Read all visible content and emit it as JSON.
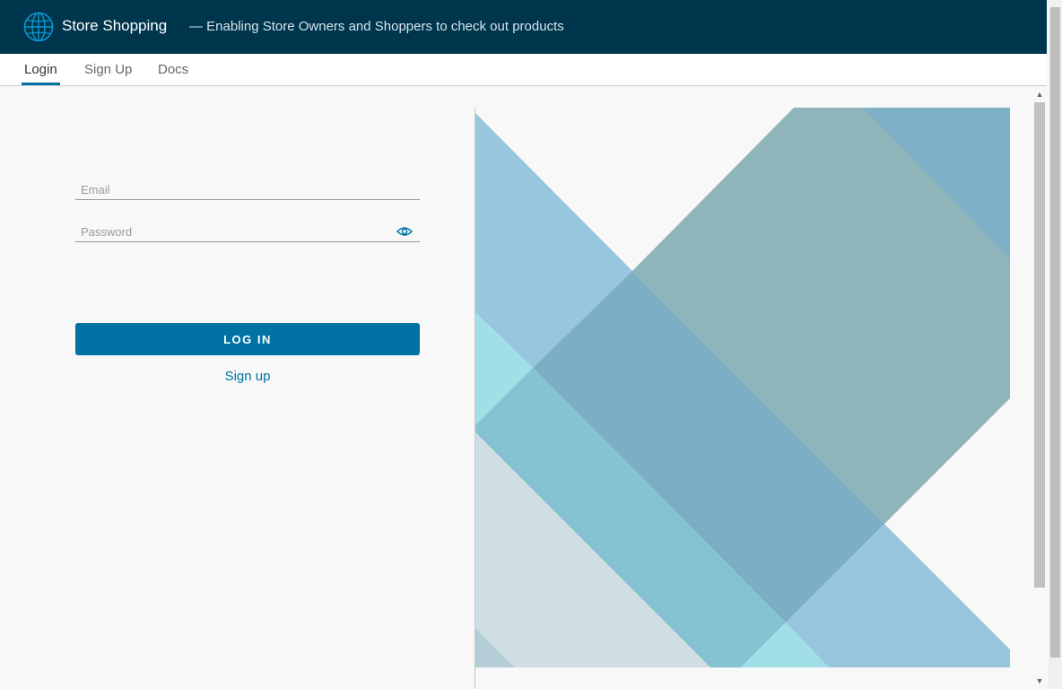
{
  "header": {
    "app_title": "Store Shopping",
    "tagline": "— Enabling Store Owners and Shoppers to check out products",
    "logo_icon": "globe-icon",
    "background_color": "#00364d"
  },
  "nav": {
    "tabs": [
      {
        "label": "Login",
        "active": true
      },
      {
        "label": "Sign Up",
        "active": false
      },
      {
        "label": "Docs",
        "active": false
      }
    ]
  },
  "login": {
    "email_placeholder": "Email",
    "email_value": "",
    "password_placeholder": "Password",
    "password_value": "",
    "password_toggle_icon": "eye-icon",
    "login_button_label": "LOG IN",
    "signup_link_label": "Sign up"
  },
  "colors": {
    "accent": "#0072a3",
    "page_background": "#f8f8f8"
  }
}
